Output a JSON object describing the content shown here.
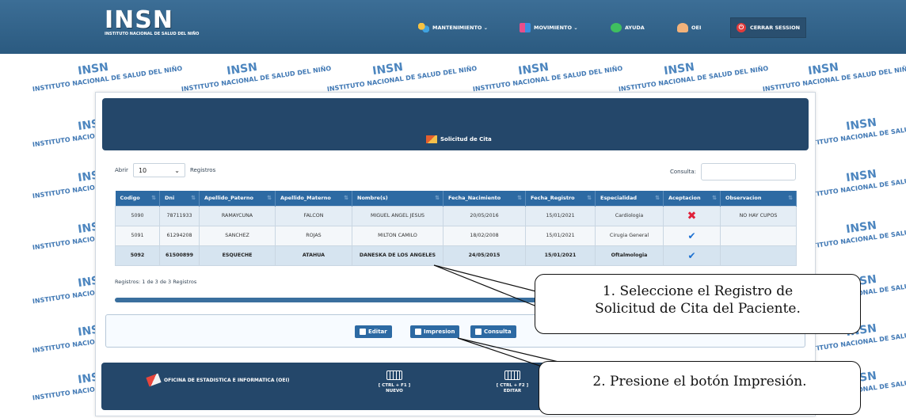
{
  "brand": {
    "logo_word": "INSN",
    "logo_sub": "INSTITUTO NACIONAL DE SALUD DEL NIÑO"
  },
  "nav": {
    "items": [
      {
        "label": "MANTENIMIENTO ⌄",
        "icon": "gears-icon"
      },
      {
        "label": "MOVIMIENTO ⌄",
        "icon": "flag-icon"
      },
      {
        "label": "AYUDA",
        "icon": "help-icon"
      },
      {
        "label": "OEI",
        "icon": "user-icon"
      }
    ],
    "logout_label": "CERRAR SESSION"
  },
  "watermark": {
    "logo": "INSN",
    "text": "INSTITUTO NACIONAL DE SALUD DEL NIÑO"
  },
  "page": {
    "title": "Solicitud de Cita"
  },
  "table_controls": {
    "show_label": "Abrir",
    "page_size": "10",
    "records_label": "Registros",
    "search_label": "Consulta:"
  },
  "table": {
    "columns": [
      "Codigo",
      "Dni",
      "Apellido_Paterno",
      "Apellido_Materno",
      "Nombre(s)",
      "Fecha_Nacimiento",
      "Fecha_Registro",
      "Especialidad",
      "Aceptacion",
      "Observacion"
    ],
    "rows": [
      {
        "codigo": "5090",
        "dni": "78711933",
        "ap_paterno": "RAMAYCUNA",
        "ap_materno": "FALCON",
        "nombres": "MIGUEL ANGEL JESUS",
        "fecha_nac": "20/05/2016",
        "fecha_reg": "15/01/2021",
        "especialidad": "Cardiologia",
        "aceptacion": "✖",
        "observacion": "NO HAY CUPOS"
      },
      {
        "codigo": "5091",
        "dni": "61294208",
        "ap_paterno": "SANCHEZ",
        "ap_materno": "ROJAS",
        "nombres": "MILTON CAMILO",
        "fecha_nac": "18/02/2008",
        "fecha_reg": "15/01/2021",
        "especialidad": "Cirugia General",
        "aceptacion": "✔",
        "observacion": ""
      },
      {
        "codigo": "5092",
        "dni": "61500899",
        "ap_paterno": "ESQUECHE",
        "ap_materno": "ATAHUA",
        "nombres": "DANESKA DE LOS ANGELES",
        "fecha_nac": "24/05/2015",
        "fecha_reg": "15/01/2021",
        "especialidad": "Oftalmologia",
        "aceptacion": "✔",
        "observacion": ""
      }
    ],
    "info": "Registros: 1 de 3 de 3 Registros"
  },
  "actions": {
    "edit_label": "Editar",
    "print_label": "Impresion",
    "query_label": "Consulta"
  },
  "footer": {
    "office": "OFICINA DE ESTADISTICA E INFORMATICA (OEI)",
    "shortcuts": [
      {
        "keys": "[ CTRL + F1 ]",
        "action": "NUEVO"
      },
      {
        "keys": "[ CTRL + F2 ]",
        "action": "EDITAR"
      }
    ]
  },
  "callouts": {
    "step1_line1": "1. Seleccione el Registro de",
    "step1_line2": "Solicitud de Cita del Paciente.",
    "step2": "2. Presione el botón Impresión."
  },
  "colors": {
    "nav_bg": "#2b5a80",
    "header_bg": "#24476a",
    "table_header": "#2d6aa3",
    "reject": "#e0213a",
    "accept": "#1a6fd1"
  }
}
